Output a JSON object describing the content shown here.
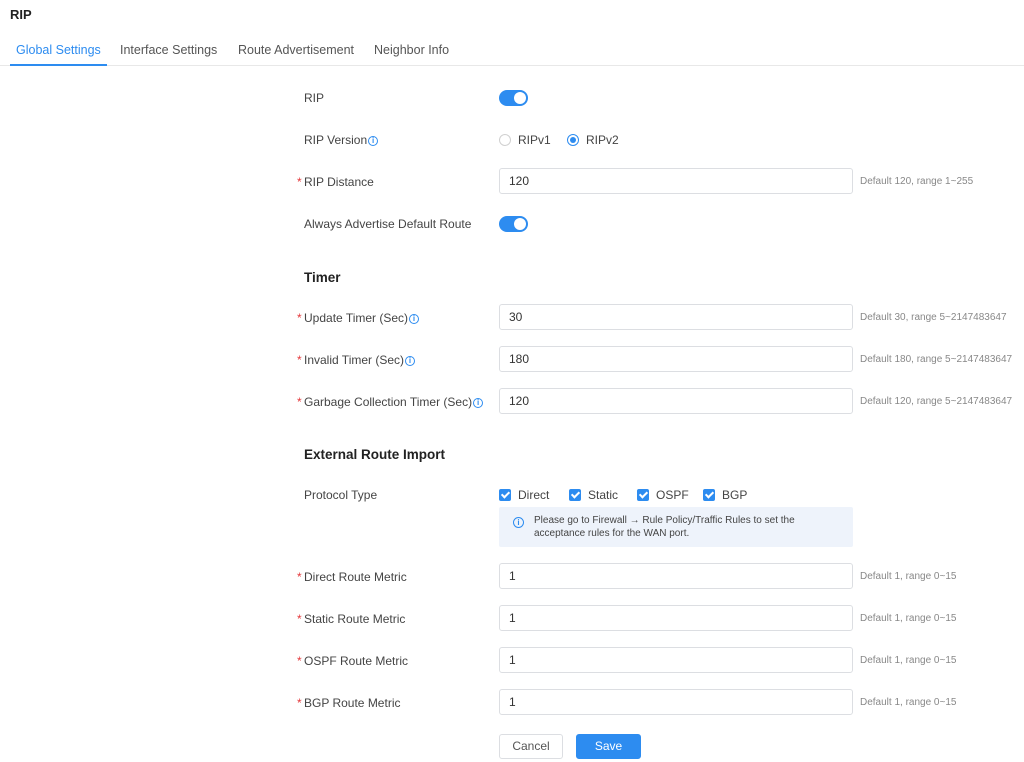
{
  "title": "RIP",
  "tabs": [
    {
      "label": "Global Settings"
    },
    {
      "label": "Interface Settings"
    },
    {
      "label": "Route Advertisement"
    },
    {
      "label": "Neighbor Info"
    }
  ],
  "fields": {
    "rip": {
      "label": "RIP",
      "enabled": true
    },
    "version": {
      "label": "RIP Version",
      "options": [
        "RIPv1",
        "RIPv2"
      ],
      "selected": "RIPv2"
    },
    "distance": {
      "label": "RIP Distance",
      "value": "120",
      "hint": "Default 120, range 1~255"
    },
    "default_route": {
      "label": "Always Advertise Default Route",
      "enabled": true
    }
  },
  "timer": {
    "title": "Timer",
    "update": {
      "label": "Update Timer (Sec)",
      "value": "30",
      "hint": "Default 30, range 5~2147483647"
    },
    "invalid": {
      "label": "Invalid Timer (Sec)",
      "value": "180",
      "hint": "Default 180, range 5~2147483647"
    },
    "garbage": {
      "label": "Garbage Collection Timer (Sec)",
      "value": "120",
      "hint": "Default 120, range 5~2147483647"
    }
  },
  "external": {
    "title": "External Route Import",
    "protocol_label": "Protocol Type",
    "protocols": [
      {
        "label": "Direct",
        "checked": true
      },
      {
        "label": "Static",
        "checked": true
      },
      {
        "label": "OSPF",
        "checked": true
      },
      {
        "label": "BGP",
        "checked": true
      }
    ],
    "notice": "Please go to Firewall → Rule Policy/Traffic Rules to set the acceptance rules for the WAN port.",
    "direct_metric": {
      "label": "Direct Route Metric",
      "value": "1",
      "hint": "Default 1, range 0~15"
    },
    "static_metric": {
      "label": "Static Route Metric",
      "value": "1",
      "hint": "Default 1, range 0~15"
    },
    "ospf_metric": {
      "label": "OSPF Route Metric",
      "value": "1",
      "hint": "Default 1, range 0~15"
    },
    "bgp_metric": {
      "label": "BGP Route Metric",
      "value": "1",
      "hint": "Default 1, range 0~15"
    }
  },
  "buttons": {
    "cancel": "Cancel",
    "save": "Save"
  },
  "colors": {
    "accent": "#2d8cf0",
    "required": "#e4393c",
    "notice_bg": "#eef3fb"
  },
  "required_mark": "*",
  "info_glyph": "i"
}
